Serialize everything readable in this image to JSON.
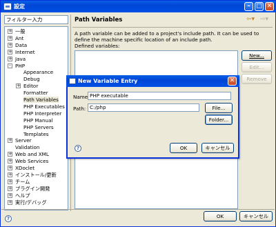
{
  "window": {
    "title": "設定"
  },
  "filter": {
    "value": "フィルター入力"
  },
  "tree": [
    {
      "label": "一般",
      "exp": "+",
      "level": 0
    },
    {
      "label": "Ant",
      "exp": "+",
      "level": 0
    },
    {
      "label": "Data",
      "exp": "+",
      "level": 0
    },
    {
      "label": "Internet",
      "exp": "+",
      "level": 0
    },
    {
      "label": "Java",
      "exp": "+",
      "level": 0
    },
    {
      "label": "PHP",
      "exp": "-",
      "level": 0
    },
    {
      "label": "Appearance",
      "exp": "",
      "level": 1
    },
    {
      "label": "Debug",
      "exp": "",
      "level": 1
    },
    {
      "label": "Editor",
      "exp": "+",
      "level": 1
    },
    {
      "label": "Formatter",
      "exp": "",
      "level": 1
    },
    {
      "label": "Path Variables",
      "exp": "",
      "level": 1,
      "selected": true
    },
    {
      "label": "PHP Executables",
      "exp": "",
      "level": 1
    },
    {
      "label": "PHP Interpreter",
      "exp": "",
      "level": 1
    },
    {
      "label": "PHP Manual",
      "exp": "",
      "level": 1
    },
    {
      "label": "PHP Servers",
      "exp": "",
      "level": 1
    },
    {
      "label": "Templates",
      "exp": "",
      "level": 1
    },
    {
      "label": "Server",
      "exp": "+",
      "level": 0
    },
    {
      "label": "Validation",
      "exp": "",
      "level": 0
    },
    {
      "label": "Web and XML",
      "exp": "+",
      "level": 0
    },
    {
      "label": "Web Services",
      "exp": "+",
      "level": 0
    },
    {
      "label": "XDoclet",
      "exp": "+",
      "level": 0
    },
    {
      "label": "インストール/更新",
      "exp": "+",
      "level": 0
    },
    {
      "label": "チーム",
      "exp": "+",
      "level": 0
    },
    {
      "label": "プラグイン開発",
      "exp": "+",
      "level": 0
    },
    {
      "label": "ヘルプ",
      "exp": "+",
      "level": 0
    },
    {
      "label": "実行/デバッグ",
      "exp": "+",
      "level": 0
    }
  ],
  "page": {
    "title": "Path Variables",
    "description": "A path variable can be added to a project's include path. It can be used to define the machine specific location of an include path.",
    "list_label": "Defined variables:",
    "new_label": "New...",
    "edit_label": "Edit...",
    "remove_label": "Remove"
  },
  "footer": {
    "ok_label": "OK",
    "cancel_label": "キャンセル"
  },
  "dialog": {
    "title": "New Variable Entry",
    "name_label": "Name:",
    "name_value": "PHP executable",
    "path_label": "Path:",
    "path_value": "C:/php",
    "file_label": "File...",
    "folder_label": "Folder...",
    "ok_label": "OK",
    "cancel_label": "キャンセル"
  }
}
